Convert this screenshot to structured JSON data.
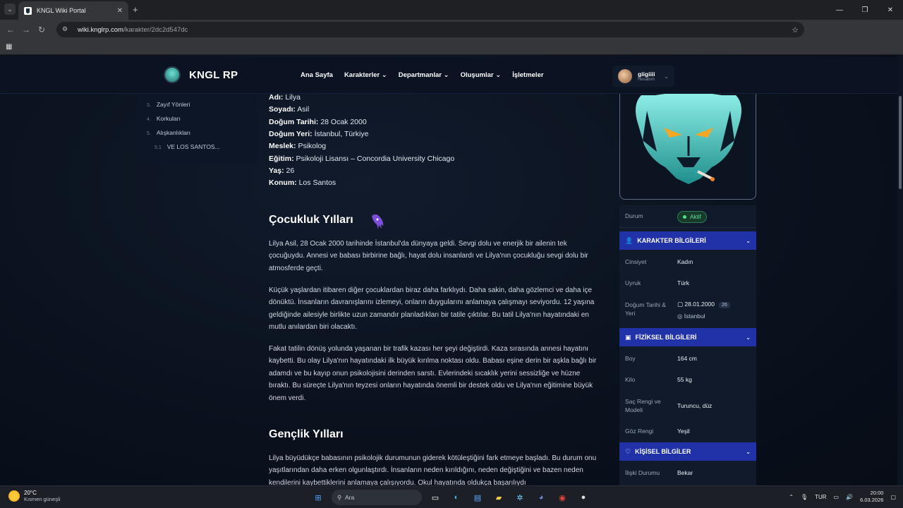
{
  "browser": {
    "tab_title": "KNGL Wiki Portal",
    "url_host": "wiki.knglrp.com",
    "url_path": "/karakter/2dc2d547dc"
  },
  "site": {
    "brand": "KNGL RP",
    "nav": [
      {
        "label": "Ana Sayfa",
        "has_menu": false
      },
      {
        "label": "Karakterler",
        "has_menu": true
      },
      {
        "label": "Departmanlar",
        "has_menu": true
      },
      {
        "label": "Oluşumlar",
        "has_menu": true
      },
      {
        "label": "İşletmeler",
        "has_menu": false
      }
    ],
    "user": {
      "name": "giigiiii",
      "subtitle": "Hesabım"
    }
  },
  "toc": {
    "items": [
      {
        "num": "3.",
        "label": "Zayıf Yönleri"
      },
      {
        "num": "4.",
        "label": "Korkuları"
      },
      {
        "num": "5.",
        "label": "Alışkanlıkları"
      },
      {
        "num": "5.1",
        "label": "VE LOS SANTOS..."
      }
    ]
  },
  "facts": [
    {
      "k": "Adı:",
      "v": "Lilya"
    },
    {
      "k": "Soyadı:",
      "v": "Asil"
    },
    {
      "k": "Doğum Tarihi:",
      "v": "28 Ocak 2000"
    },
    {
      "k": "Doğum Yeri:",
      "v": "İstanbul, Türkiye"
    },
    {
      "k": "Meslek:",
      "v": "Psikolog"
    },
    {
      "k": "Eğitim:",
      "v": "Psikoloji Lisansı – Concordia University Chicago"
    },
    {
      "k": "Yaş:",
      "v": "26"
    },
    {
      "k": "Konum:",
      "v": "Los Santos"
    }
  ],
  "sections": {
    "childhood_title": "Çocukluk Yılları",
    "childhood": [
      "Lilya Asil, 28 Ocak 2000 tarihinde İstanbul'da dünyaya geldi. Sevgi dolu ve enerjik bir ailenin tek çocuğuydu. Annesi ve babası birbirine bağlı, hayat dolu insanlardı ve Lilya'nın çocukluğu sevgi dolu bir atmosferde geçti.",
      "Küçük yaşlardan itibaren diğer çocuklardan biraz daha farklıydı. Daha sakin, daha gözlemci ve daha içe dönüktü. İnsanların davranışlarını izlemeyi, onların duygularını anlamaya çalışmayı seviyordu. 12 yaşına geldiğinde ailesiyle birlikte uzun zamandır planladıkları bir tatile çıktılar. Bu tatil Lilya'nın hayatındaki en mutlu anılardan biri olacaktı.",
      "Fakat tatilin dönüş yolunda yaşanan bir trafik kazası her şeyi değiştirdi. Kaza sırasında annesi hayatını kaybetti. Bu olay Lilya'nın hayatındaki ilk büyük kırılma noktası oldu. Babası eşine derin bir aşkla bağlı bir adamdı ve bu kayıp onun psikolojisini derinden sarstı. Evlerindeki sıcaklık yerini sessizliğe ve hüzne bıraktı. Bu süreçte Lilya'nın teyzesi onların hayatında önemli bir destek oldu ve Lilya'nın eğitimine büyük önem verdi."
    ],
    "youth_title": "Gençlik Yılları",
    "youth": "Lilya büyüdükçe babasının psikolojik durumunun giderek kötüleştiğini fark etmeye başladı. Bu durum onu yaşıtlarından daha erken olgunlaştırdı. İnsanların neden kırıldığını, neden değiştiğini ve bazen neden kendilerini kaybettiklerini anlamaya çalışıyordu. Okul hayatında oldukça başarılıydı"
  },
  "card": {
    "status_label": "Durum",
    "status_value": "Aktif",
    "character_section": "KARAKTER BİLGİLERİ",
    "gender_label": "Cinsiyet",
    "gender": "Kadın",
    "nationality_label": "Uyruk",
    "nationality": "Türk",
    "birth_label": "Doğum Tarihi & Yeri",
    "birth_date": "28.01.2000",
    "age": "26",
    "birth_place": "İstanbul",
    "physical_section": "FİZİKSEL BİLGİLERİ",
    "height_label": "Boy",
    "height": "164 cm",
    "weight_label": "Kilo",
    "weight": "55 kg",
    "hair_label": "Saç Rengi ve Modeli",
    "hair": "Turuncu, düz",
    "eye_label": "Göz Rengi",
    "eye": "Yeşil",
    "personal_section": "KİŞİSEL BİLGİLER",
    "relationship_label": "İlişki Durumu",
    "relationship": "Bekar"
  },
  "taskbar": {
    "temp": "20°C",
    "weather": "Kısmen güneşli",
    "search_placeholder": "Ara",
    "lang": "TUR",
    "time": "20:00",
    "date": "6.03.2026"
  },
  "colors": {
    "accent": "#2131a8",
    "status_green": "#4ee08e"
  }
}
